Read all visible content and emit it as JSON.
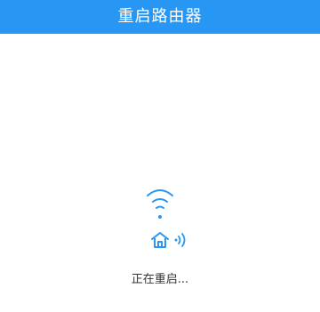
{
  "header": {
    "title": "重启路由器",
    "background": "#2896f3",
    "title_color": "#ffffff"
  },
  "status": {
    "text": "正在重启...",
    "icon_color": "#2896f3",
    "icons": [
      "wifi-icon",
      "house-icon",
      "signal-icon"
    ]
  }
}
